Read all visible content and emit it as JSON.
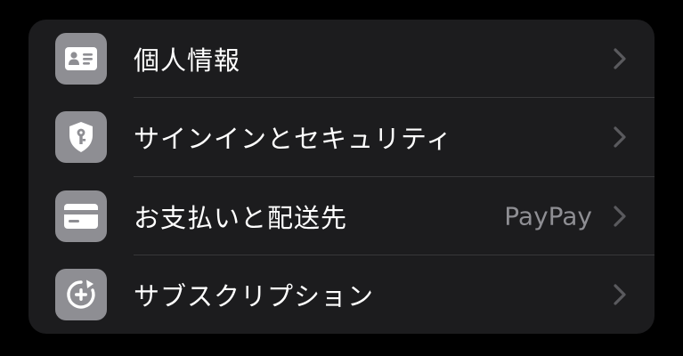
{
  "colors": {
    "background": "#000000",
    "group_background": "#1c1c1e",
    "icon_tile": "#8e8e93",
    "label": "#ffffff",
    "secondary": "#8e8e93",
    "divider": "#38383a"
  },
  "settings": {
    "rows": [
      {
        "label": "個人情報",
        "value": "",
        "icon": "contact-card-icon"
      },
      {
        "label": "サインインとセキュリティ",
        "value": "",
        "icon": "key-shield-icon"
      },
      {
        "label": "お支払いと配送先",
        "value": "PayPay",
        "icon": "credit-card-icon"
      },
      {
        "label": "サブスクリプション",
        "value": "",
        "icon": "subscription-add-icon"
      }
    ]
  }
}
